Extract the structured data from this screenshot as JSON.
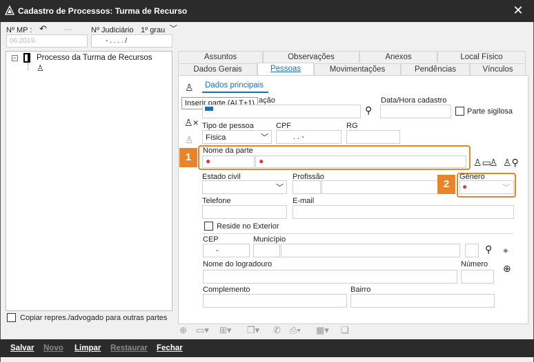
{
  "window": {
    "title": "Cadastro de Processos: Turma de Recurso",
    "close_icon": "close-icon"
  },
  "header": {
    "mp_label": "Nº MP :",
    "judiciario_label": "Nº Judiciário",
    "grau_value": "1º grau",
    "mp_value": "06.2019.",
    "judiciario_value": "-  .    .  .    .    /"
  },
  "tree": {
    "root_label": "Processo da Turma de Recursos",
    "child_label": ""
  },
  "copy_checkbox_label": "Copiar repres./advogado para outras partes",
  "tabs_row1": [
    "Assuntos",
    "Observações",
    "Anexos",
    "Local Físico"
  ],
  "tabs_row2": [
    "Dados Gerais",
    "Pessoas",
    "Movimentações",
    "Pendências",
    "Vínculos"
  ],
  "active_tab": "Pessoas",
  "subtab": "Dados principais",
  "tooltip": "Inserir parte (ALT+1)",
  "form": {
    "qualificacao_label": "ação",
    "data_hora_label": "Data/Hora cadastro",
    "parte_sigilosa_label": "Parte sigilosa",
    "tipo_pessoa_label": "Tipo de pessoa",
    "tipo_pessoa_value": "Física",
    "cpf_label": "CPF",
    "cpf_value": ".    .    -",
    "rg_label": "RG",
    "nome_parte_label": "Nome da parte",
    "estado_civil_label": "Estado civil",
    "profissao_label": "Profissão",
    "genero_label": "Gênero",
    "telefone_label": "Telefone",
    "email_label": "E-mail",
    "reside_exterior_label": "Reside no Exterior",
    "cep_label": "CEP",
    "cep_value": "-",
    "municipio_label": "Município",
    "logradouro_label": "Nome do logradouro",
    "numero_label": "Número",
    "complemento_label": "Complemento",
    "bairro_label": "Bairro"
  },
  "badges": [
    "1",
    "2"
  ],
  "bottom": {
    "salvar": "Salvar",
    "novo": "Novo",
    "limpar": "Limpar",
    "restaurar": "Restaurar",
    "fechar": "Fechar"
  },
  "colors": {
    "accent": "#1a6fb5",
    "highlight": "#e8852b",
    "required": "#e03a3a"
  }
}
